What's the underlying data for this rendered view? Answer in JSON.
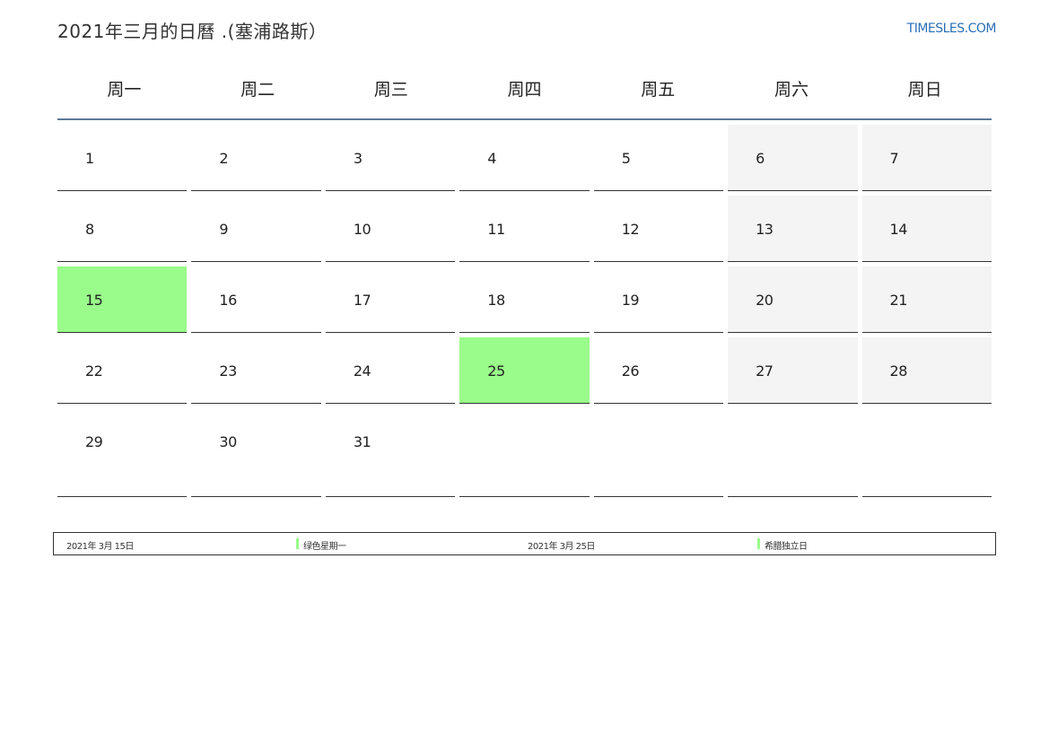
{
  "header": {
    "title": "2021年三月的日曆 .(塞浦路斯）",
    "brand": "TIMESLES.COM"
  },
  "weekdays": [
    "周一",
    "周二",
    "周三",
    "周四",
    "周五",
    "周六",
    "周日"
  ],
  "weeks": [
    [
      "1",
      "2",
      "3",
      "4",
      "5",
      "6",
      "7"
    ],
    [
      "8",
      "9",
      "10",
      "11",
      "12",
      "13",
      "14"
    ],
    [
      "15",
      "16",
      "17",
      "18",
      "19",
      "20",
      "21"
    ],
    [
      "22",
      "23",
      "24",
      "25",
      "26",
      "27",
      "28"
    ],
    [
      "29",
      "30",
      "31",
      "",
      "",
      "",
      ""
    ]
  ],
  "holidays": [
    {
      "date": "2021年 3月 15日",
      "name": "绿色星期一"
    },
    {
      "date": "2021年 3月 25日",
      "name": "希腊独立日"
    }
  ],
  "colors": {
    "holiday": "#9afc8a",
    "weekend": "#f4f4f4",
    "header_rule": "#5d7a98",
    "brand": "#2a6fb5"
  }
}
